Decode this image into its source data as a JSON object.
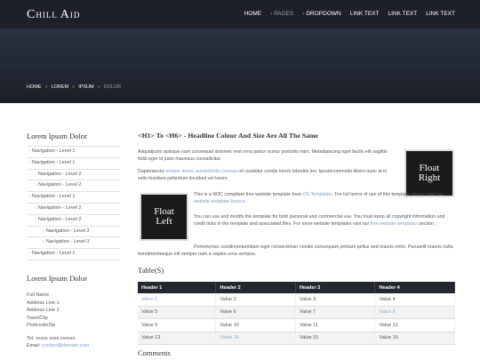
{
  "header": {
    "logo_parts": [
      "C",
      "HILL ",
      "A",
      "ID"
    ],
    "nav": [
      {
        "label": "HOME",
        "bullet": false,
        "muted": false
      },
      {
        "label": "PAGES",
        "bullet": true,
        "muted": true
      },
      {
        "label": "DROPDOWN",
        "bullet": true,
        "muted": false
      },
      {
        "label": "LINK TEXT",
        "bullet": false,
        "muted": false
      },
      {
        "label": "LINK TEXT",
        "bullet": false,
        "muted": false
      },
      {
        "label": "LINK TEXT",
        "bullet": false,
        "muted": false
      }
    ]
  },
  "breadcrumb": {
    "items": [
      "HOME",
      "LOREM",
      "IPSUM"
    ],
    "current": "DOLOR",
    "separator": "»"
  },
  "sidebar": {
    "title": "Lorem Ipsum Dolor",
    "items": [
      {
        "label": "Navigation - Level 1",
        "level": 1
      },
      {
        "label": "Navigation - Level 1",
        "level": 1
      },
      {
        "label": "Navigation - Level 2",
        "level": 2
      },
      {
        "label": "Navigation - Level 2",
        "level": 2
      },
      {
        "label": "Navigation - Level 1",
        "level": 1
      },
      {
        "label": "Navigation - Level 2",
        "level": 2
      },
      {
        "label": "Navigation - Level 2",
        "level": 2
      },
      {
        "label": "Navigation - Level 3",
        "level": 3
      },
      {
        "label": "Navigation - Level 3",
        "level": 3
      },
      {
        "label": "Navigation - Level 1",
        "level": 1
      }
    ]
  },
  "address": {
    "title": "Lorem Ipsum Dolor",
    "lines": [
      "Full Name",
      "Address Line 1",
      "Address Line 2",
      "Town/City",
      "Postcode/Zip"
    ],
    "tel": "Tel: xxxxx xxxx xxxxxx",
    "email_label": "Email: ",
    "email": "contact@domain.com"
  },
  "main": {
    "heading": "<H1> To <H6> - Headline Colour And Size Are All The Same",
    "p1": "Aliquatjusto quisque nam consequat doloreet vest orna partur scetur portortis nam. Metadipiscing eget facilis elit sagittis felisi eger id justo maurisus convallicitur.",
    "p2_a": "Dapiensociis ",
    "p2_link": "temper donec auctoritortis cumsan",
    "p2_b": " et curabitur condis lorem loborttis leo. Ipsumcommodo libero nunc at in velis tincidunt pellentum tincidunt vel lorem.",
    "float_right": "Float Right",
    "float_left": "Float Left",
    "p3_a": "This is a W3C compliant free website template from ",
    "p3_link1": "OS Templates",
    "p3_b": ". For full terms of use of this template please read our ",
    "p3_link2": "website template licence",
    "p3_c": ".",
    "p4_a": "You can use and modify the template for both personal and commercial use. You must keep all copyright information and credit links in the template and associated files. For more website templates visit our ",
    "p4_link": "free website templates",
    "p4_b": " section.",
    "p5": "Portortornec condimentumdiam eget consectetuer condis consequam pretium pellus sed mauris enim. Puruselit mauris nulla hendimentesque elit semper nam a sapien urna sempus.",
    "table_title": "Table(S)",
    "table": {
      "headers": [
        "Header 1",
        "Header 2",
        "Header 3",
        "Header 4"
      ],
      "rows": [
        [
          "Value 1",
          "Value 2",
          "Value 3",
          "Value 4"
        ],
        [
          "Value 5",
          "Value 6",
          "Value 7",
          "Value 8"
        ],
        [
          "Value 9",
          "Value 10",
          "Value 11",
          "Value 12"
        ],
        [
          "Value 13",
          "Value 14",
          "Value 15",
          "Value 16"
        ]
      ],
      "link_cells": [
        "0-0",
        "1-3",
        "3-1"
      ]
    },
    "comments_title": "Comments"
  }
}
